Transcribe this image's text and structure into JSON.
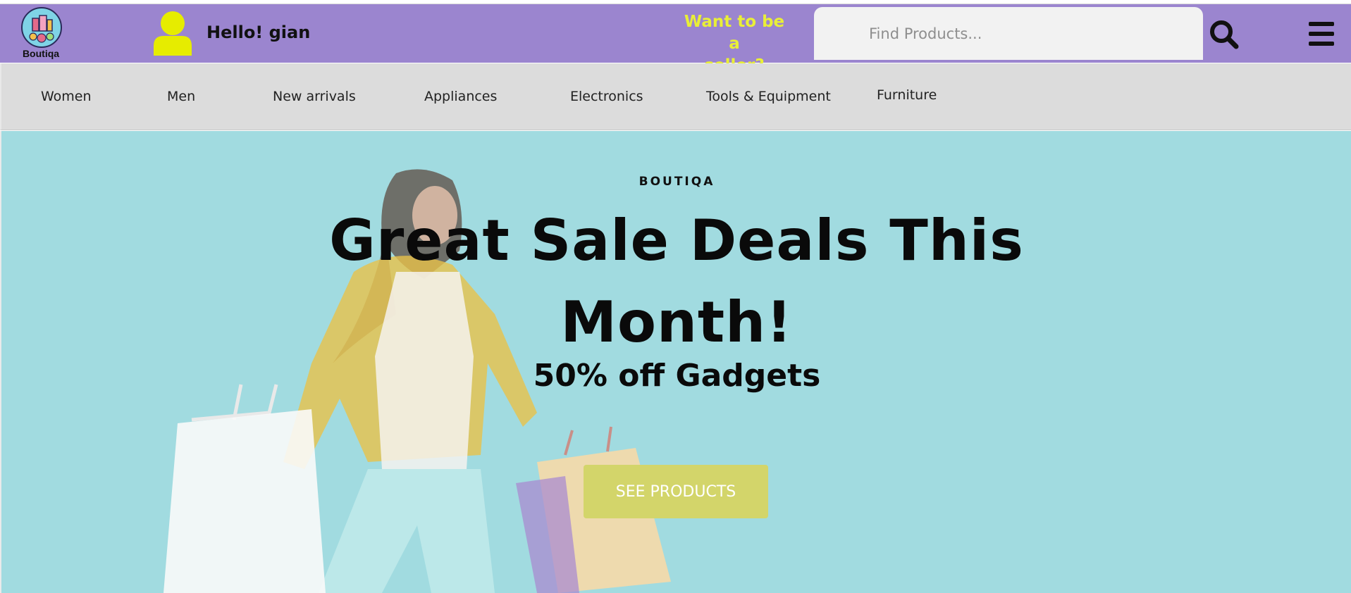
{
  "header": {
    "logo_text": "Boutiqa",
    "greeting": "Hello! gian",
    "seller_line1": "Want to be a",
    "seller_line2": "seller?",
    "search_placeholder": "Find Products...",
    "search_icon": "search-icon",
    "menu_icon": "hamburger-menu-icon",
    "user_icon": "user-avatar-icon"
  },
  "nav": {
    "categories": [
      "Women",
      "Men",
      "New arrivals",
      "Appliances",
      "Electronics",
      "Tools & Equipment",
      "Furniture"
    ]
  },
  "hero": {
    "eyebrow": "BOUTIQA",
    "headline_line1": "Great Sale Deals This",
    "headline_line2": "Month!",
    "subline": "50% off Gadgets",
    "cta_label": "SEE PRODUCTS"
  },
  "colors": {
    "header_bg": "#9b85cf",
    "accent_yellow": "#e9ef37",
    "nav_bg": "#dcdcdc",
    "hero_bg": "#a1dbe0",
    "cta_bg": "#d3d56a"
  }
}
